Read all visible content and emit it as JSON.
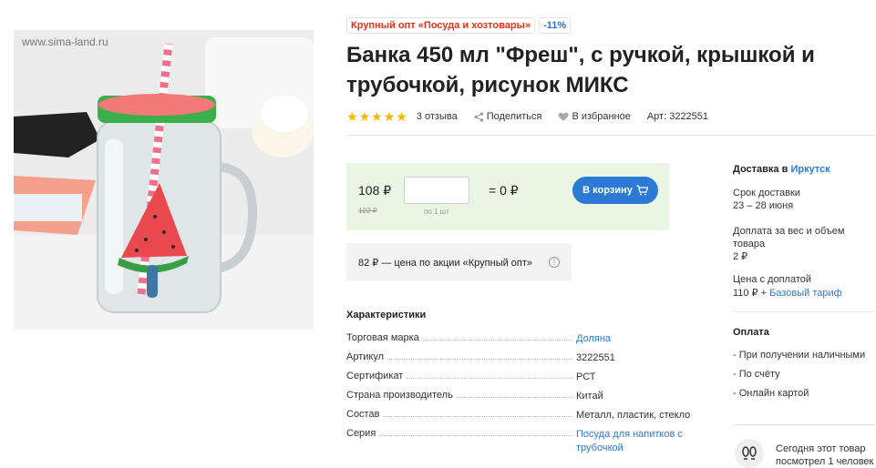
{
  "image": {
    "watermark": "www.sima-land.ru"
  },
  "badges": {
    "promo": "Крупный опт «Посуда и хозтовары»",
    "discount": "-11%"
  },
  "title": "Банка 450 мл \"Фреш\", с ручкой, крышкой и трубочкой, рисунок МИКС",
  "meta": {
    "rating_stars": 5,
    "reviews": "3 отзыва",
    "share": "Поделиться",
    "favorite": "В избранное",
    "article": "Арт: 3222551"
  },
  "price": {
    "current": "108 ₽",
    "old": "122 ₽",
    "qty_value": "",
    "per_unit": "по 1 шт",
    "total": "= 0 ₽",
    "cart_button": "В корзину"
  },
  "promo": {
    "text": "82 ₽ — цена по акции «Крупный опт»"
  },
  "characteristics": {
    "title": "Характеристики",
    "rows": [
      {
        "key": "Торговая марка",
        "value": "Доляна"
      },
      {
        "key": "Артикул",
        "value": "3222551"
      },
      {
        "key": "Сертификат",
        "value": "РСТ"
      },
      {
        "key": "Страна производитель",
        "value": "Китай"
      },
      {
        "key": "Состав",
        "value": "Металл, пластик, стекло"
      },
      {
        "key": "Серия",
        "value": "Посуда для напитков с трубочкой"
      }
    ]
  },
  "delivery": {
    "heading": "Доставка в",
    "city": "Иркутск",
    "term_label": "Срок доставки",
    "term_value": "23 – 28 июня",
    "surcharge_label": "Доплата за вес и объем товара",
    "surcharge_value": "2 ₽",
    "price_label": "Цена с доплатой",
    "price_value": "110 ₽ +",
    "tariff": "Базовый тариф"
  },
  "payment": {
    "heading": "Оплата",
    "items": [
      "- При получении наличными",
      "- По счёту",
      "- Онлайн картой"
    ]
  },
  "viewed": {
    "text": "Сегодня этот товар посмотрел 1 человек"
  },
  "colors": {
    "accent": "#2c7ad6",
    "promo_red": "#e8321e",
    "star": "#f7b500",
    "price_bg": "#e8f6e3"
  }
}
